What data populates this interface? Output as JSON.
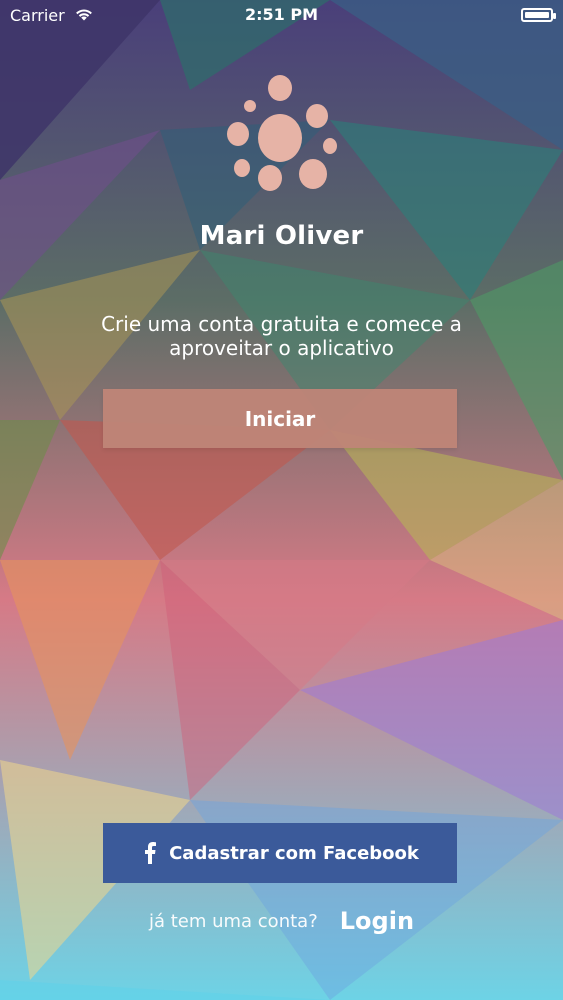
{
  "status_bar": {
    "carrier": "Carrier",
    "time": "2:51 PM"
  },
  "app": {
    "title": "Mari Oliver",
    "tagline": "Crie uma conta gratuita e comece a aproveitar o aplicativo"
  },
  "buttons": {
    "start_label": "Iniciar",
    "facebook_label": "Cadastrar com Facebook"
  },
  "login_prompt": {
    "question": "já tem uma conta?",
    "link": "Login"
  },
  "colors": {
    "button_primary": "#bf8577",
    "facebook": "#3b5a9a",
    "logo": "#e6b3a6"
  },
  "icons": {
    "logo": "dots-circle-logo",
    "facebook": "facebook-f-icon",
    "signal": "wifi-icon",
    "battery": "battery-icon"
  }
}
